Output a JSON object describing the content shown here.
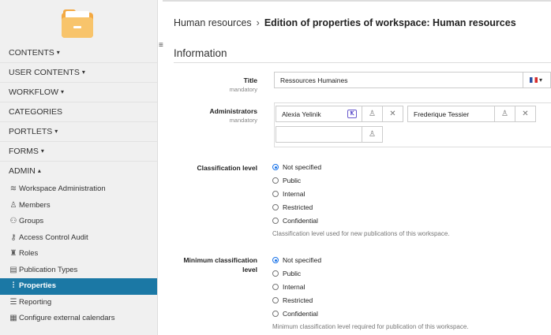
{
  "sidebar": {
    "menu": [
      {
        "label": "CONTENTS",
        "caret": "▾"
      },
      {
        "label": "USER CONTENTS",
        "caret": "▾"
      },
      {
        "label": "WORKFLOW",
        "caret": "▾"
      },
      {
        "label": "CATEGORIES",
        "caret": ""
      },
      {
        "label": "PORTLETS",
        "caret": "▾"
      },
      {
        "label": "FORMS",
        "caret": "▾"
      },
      {
        "label": "ADMIN",
        "caret": "▴"
      }
    ],
    "admin_items": [
      {
        "label": "Workspace Administration",
        "icon": "layers-icon",
        "glyph": "≋"
      },
      {
        "label": "Members",
        "icon": "user-icon",
        "glyph": "♙"
      },
      {
        "label": "Groups",
        "icon": "users-icon",
        "glyph": "⚇"
      },
      {
        "label": "Access Control Audit",
        "icon": "key-icon",
        "glyph": "⚷"
      },
      {
        "label": "Roles",
        "icon": "roles-icon",
        "glyph": "♜"
      },
      {
        "label": "Publication Types",
        "icon": "list-box-icon",
        "glyph": "▤"
      },
      {
        "label": "Properties",
        "icon": "sliders-icon",
        "glyph": "⫶"
      },
      {
        "label": "Reporting",
        "icon": "list-icon",
        "glyph": "☰"
      },
      {
        "label": "Configure external calendars",
        "icon": "calendar-icon",
        "glyph": "▦"
      }
    ],
    "active_item": "Properties"
  },
  "breadcrumb": {
    "parent": "Human resources",
    "separator": "›",
    "current": "Edition of properties of workspace: Human resources"
  },
  "section": {
    "title": "Information"
  },
  "fields": {
    "title": {
      "label": "Title",
      "mandatory": "mandatory",
      "value": "Ressources Humaines",
      "language_caret": "▾"
    },
    "administrators": {
      "label": "Administrators",
      "mandatory": "mandatory",
      "entries": [
        "Alexia Yelinik",
        "Frederique Tessier",
        ""
      ],
      "badge": "Ꝁ"
    },
    "classification": {
      "label": "Classification level",
      "options": [
        "Not specified",
        "Public",
        "Internal",
        "Restricted",
        "Confidential"
      ],
      "selected": "Not specified",
      "help": "Classification level used for new publications of this workspace."
    },
    "min_classification": {
      "label_line1": "Minimum classification",
      "label_line2": "level",
      "options": [
        "Not specified",
        "Public",
        "Internal",
        "Restricted",
        "Confidential"
      ],
      "selected": "Not specified",
      "help": "Minimum classification level required for publication of this workspace."
    }
  },
  "colors": {
    "active_bg": "#1b78a5",
    "folder": "#f3a943",
    "radio_on": "#1a73e8"
  }
}
